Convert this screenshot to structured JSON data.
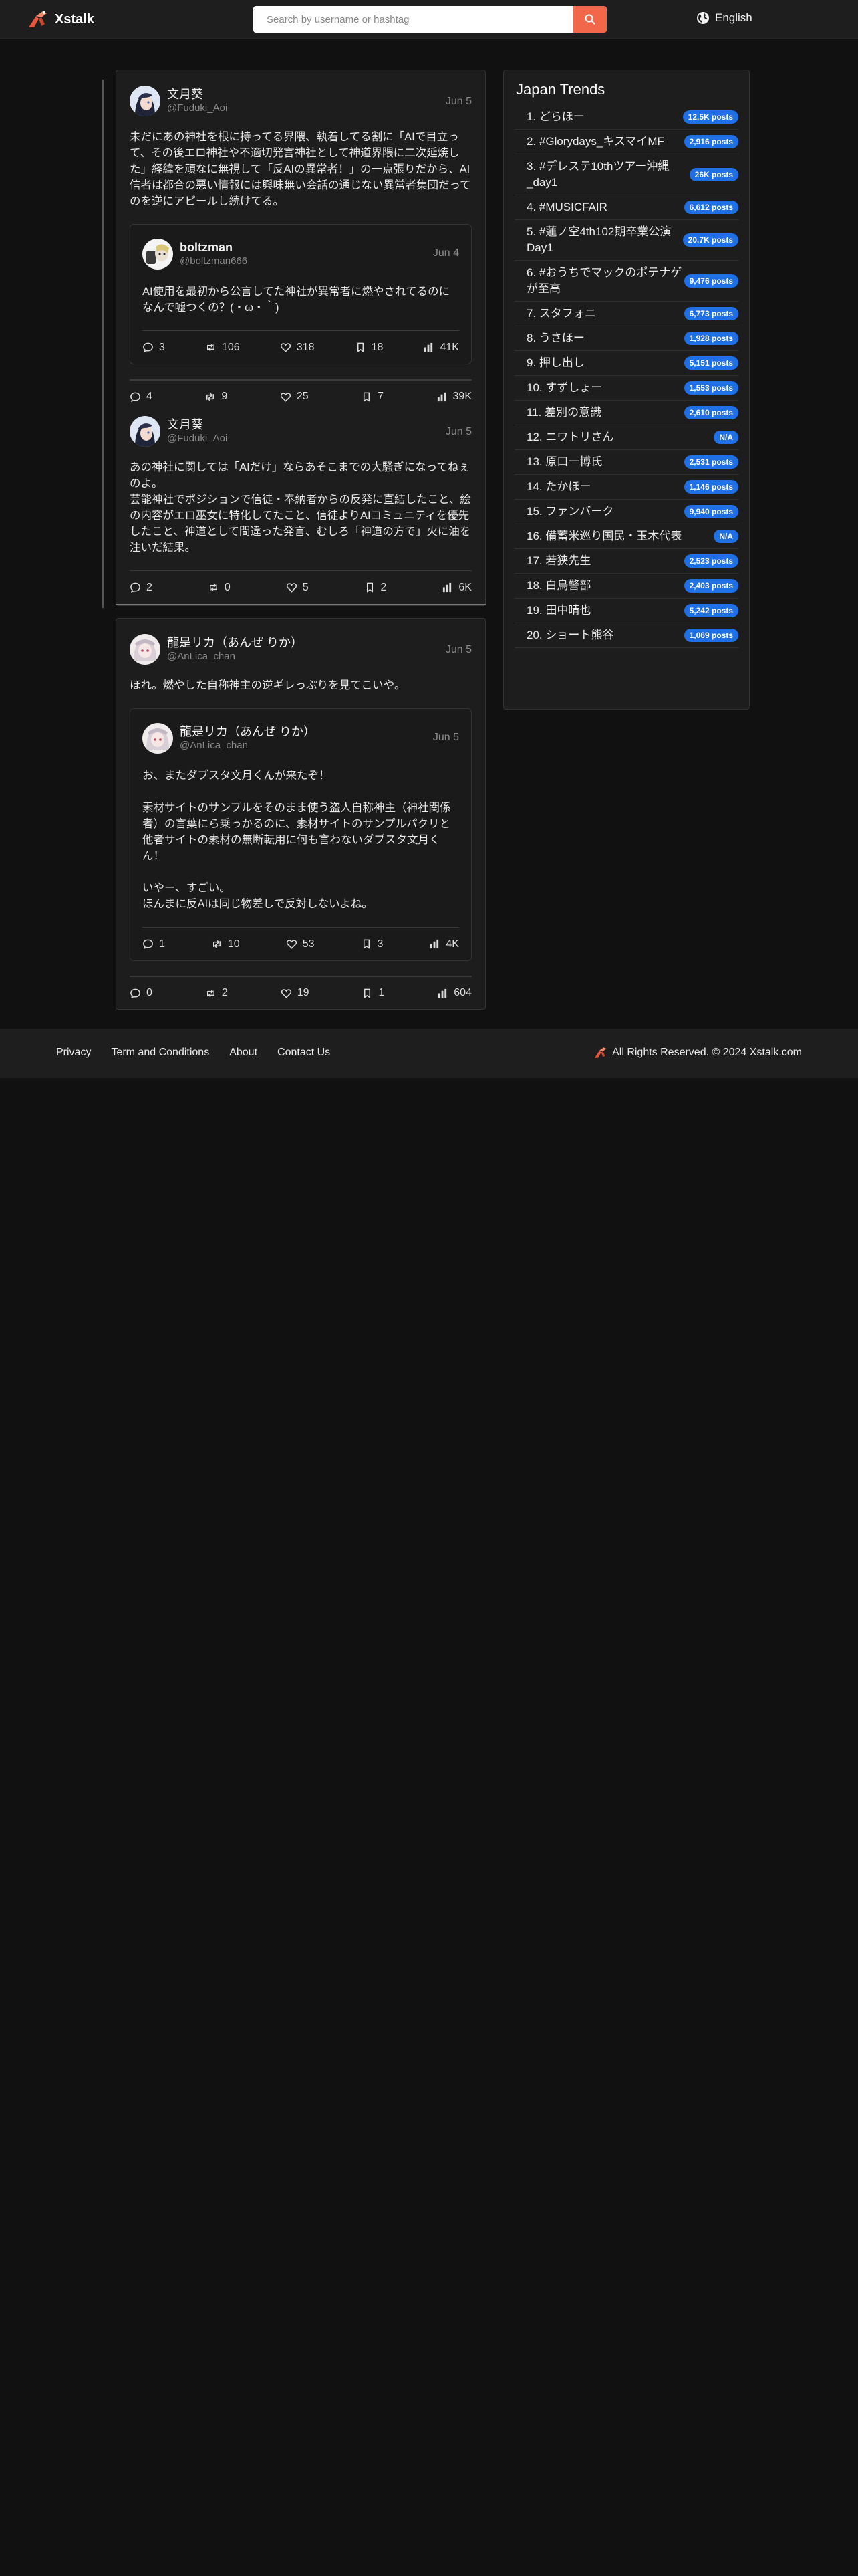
{
  "header": {
    "app_name": "Xstalk",
    "search_placeholder": "Search by username or hashtag",
    "language": "English"
  },
  "thread": [
    {
      "user": "文月葵",
      "handle": "@Fuduki_Aoi",
      "date": "Jun 5",
      "text": "未だにあの神社を根に持ってる界隈、執着してる割に「AIで目立って、その後エロ神社や不適切発言神社として神道界隈に二次延焼した」経緯を頑なに無視して「反AIの異常者！」の一点張りだから、AI信者は都合の悪い情報には興味無い会話の通じない異常者集団だってのを逆にアピールし続けてる。",
      "quote": {
        "user": "boltzman",
        "handle": "@boltzman666",
        "date": "Jun 4",
        "text": "AI使用を最初から公言してた神社が異常者に燃やされてるのになんで嘘つくの？(・ω・｀)",
        "replies": "3",
        "reposts": "106",
        "likes": "318",
        "bookmarks": "18",
        "views": "41K"
      },
      "replies": "4",
      "reposts": "9",
      "likes": "25",
      "bookmarks": "7",
      "views": "39K"
    },
    {
      "user": "文月葵",
      "handle": "@Fuduki_Aoi",
      "date": "Jun 5",
      "text": "あの神社に関しては「AIだけ」ならあそこまでの大騒ぎになってねぇのよ。\n芸能神社でポジションで信徒・奉納者からの反発に直結したこと、絵の内容がエロ巫女に特化してたこと、信徒よりAIコミュニティを優先したこと、神道として間違った発言、むしろ「神道の方で」火に油を注いだ結果。",
      "replies": "2",
      "reposts": "0",
      "likes": "5",
      "bookmarks": "2",
      "views": "6K"
    }
  ],
  "post2": {
    "user": "龍是リカ（あんぜ りか）",
    "handle": "@AnLica_chan",
    "date": "Jun 5",
    "text": "ほれ。燃やした自称神主の逆ギレっぷりを見てこいや。",
    "quote": {
      "user": "龍是リカ（あんぜ りか）",
      "handle": "@AnLica_chan",
      "date": "Jun 5",
      "text": "お、またダブスタ文月くんが来たぞ！\n\n素材サイトのサンプルをそのまま使う盗人自称神主（神社関係者）の言葉にら乗っかるのに、素材サイトのサンプルパクリと他者サイトの素材の無断転用に何も言わないダブスタ文月くん！\n\nいやー、すごい。\nほんまに反AIは同じ物差しで反対しないよね。",
      "replies": "1",
      "reposts": "10",
      "likes": "53",
      "bookmarks": "3",
      "views": "4K"
    },
    "replies": "0",
    "reposts": "2",
    "likes": "19",
    "bookmarks": "1",
    "views": "604"
  },
  "trends": {
    "title": "Japan Trends",
    "items": [
      {
        "label": "1. どらほー",
        "count": "12.5K posts"
      },
      {
        "label": "2. #Glorydays_キスマイMF",
        "count": "2,916 posts"
      },
      {
        "label": "3. #デレステ10thツアー沖縄_day1",
        "count": "26K posts"
      },
      {
        "label": "4. #MUSICFAIR",
        "count": "6,612 posts"
      },
      {
        "label": "5. #蓮ノ空4th102期卒業公演Day1",
        "count": "20.7K posts"
      },
      {
        "label": "6. #おうちでマックのポテナゲが至高",
        "count": "9,476 posts"
      },
      {
        "label": "7. スタフォニ",
        "count": "6,773 posts"
      },
      {
        "label": "8. うさほー",
        "count": "1,928 posts"
      },
      {
        "label": "9. 押し出し",
        "count": "5,151 posts"
      },
      {
        "label": "10. すずしょー",
        "count": "1,553 posts"
      },
      {
        "label": "11. 差別の意識",
        "count": "2,610 posts"
      },
      {
        "label": "12. ニワトリさん",
        "count": "N/A"
      },
      {
        "label": "13. 原口一博氏",
        "count": "2,531 posts"
      },
      {
        "label": "14. たかほー",
        "count": "1,146 posts"
      },
      {
        "label": "15. ファンバーク",
        "count": "9,940 posts"
      },
      {
        "label": "16. 備蓄米巡り国民・玉木代表",
        "count": "N/A"
      },
      {
        "label": "17. 若狭先生",
        "count": "2,523 posts"
      },
      {
        "label": "18. 白鳥警部",
        "count": "2,403 posts"
      },
      {
        "label": "19. 田中晴也",
        "count": "5,242 posts"
      },
      {
        "label": "20. ショート熊谷",
        "count": "1,069 posts"
      }
    ]
  },
  "footer": {
    "links": [
      "Privacy",
      "Term and Conditions",
      "About",
      "Contact Us"
    ],
    "copyright": "All Rights Reserved. © 2024 Xstalk.com"
  }
}
